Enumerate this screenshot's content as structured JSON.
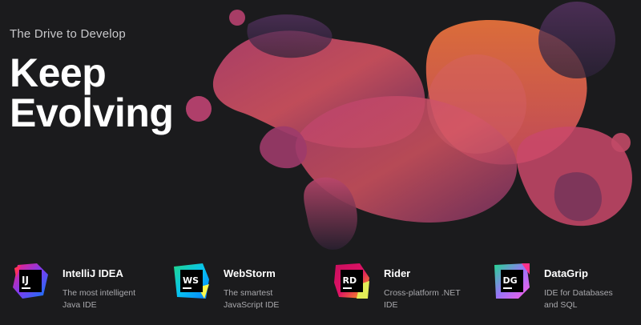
{
  "hero": {
    "tagline": "The Drive to Develop",
    "headline_line1": "Keep",
    "headline_line2": "Evolving"
  },
  "products": [
    {
      "abbr": "IJ",
      "name": "IntelliJ IDEA",
      "desc_line1": "The most intelligent",
      "desc_line2": "Java IDE"
    },
    {
      "abbr": "WS",
      "name": "WebStorm",
      "desc_line1": "The smartest",
      "desc_line2": "JavaScript IDE"
    },
    {
      "abbr": "RD",
      "name": "Rider",
      "desc_line1": "Cross-platform .NET",
      "desc_line2": "IDE"
    },
    {
      "abbr": "DG",
      "name": "DataGrip",
      "desc_line1": "IDE for Databases",
      "desc_line2": "and SQL"
    }
  ],
  "colors": {
    "background": "#1b1b1d",
    "blob_magenta": "#c63f73",
    "blob_orange": "#e0693c",
    "blob_purple": "#4a2a5c"
  },
  "icons": [
    "intellij-logo-icon",
    "webstorm-logo-icon",
    "rider-logo-icon",
    "datagrip-logo-icon"
  ]
}
